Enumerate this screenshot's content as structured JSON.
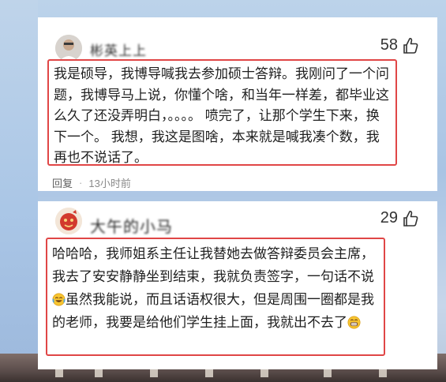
{
  "comments": [
    {
      "username": "彬英上上",
      "likes": "58",
      "text": "我是硕导，我博导喊我去参加硕士答辩。我刚问了一个问题，我博导马上说，你懂个啥，和当年一样差，都毕业这么久了还没弄明白，。。。。 喷完了，让那个学生下来，换下一个。 我想，我这是图啥，本来就是喊我凑个数，我再也不说话了。",
      "reply_label": "回复",
      "time": "13小时前"
    },
    {
      "username": "大午的小马",
      "likes": "29",
      "text_part1": "哈哈哈，我师姐系主任让我替她去做答辩委员会主席，我去了安安静静坐到结束，我就负责签字，一句话不说",
      "text_part2": "虽然我能说，而且话语权很大，但是周围一圈都是我的老师，我要是给他们学生挂上面，我就出不去了"
    }
  ],
  "icons": {
    "like": "thumbs-up-icon",
    "emoji_laugh": "laugh-cry-emoji-icon",
    "emoji_grin": "grin-emoji-icon"
  },
  "colors": {
    "highlight_border": "#e04646",
    "card_bg": "#ffffff",
    "meta_text": "#8a8a8a"
  }
}
